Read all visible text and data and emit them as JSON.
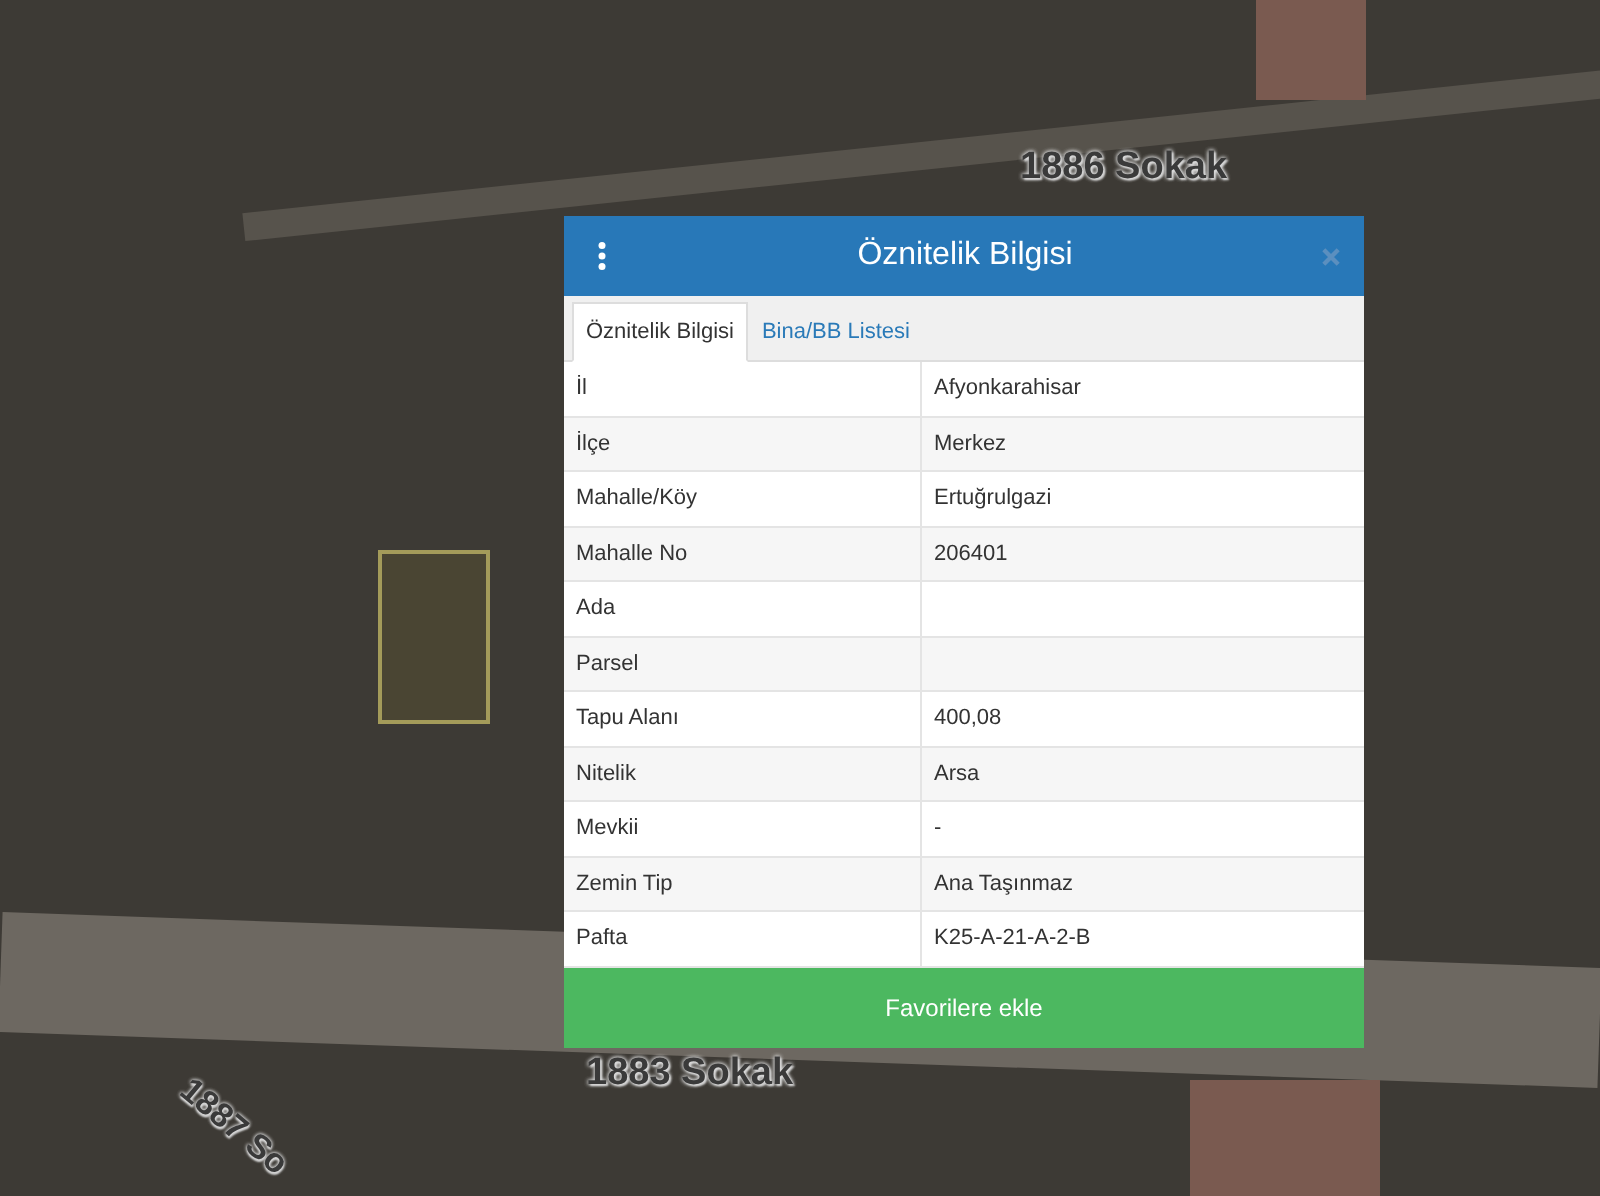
{
  "map": {
    "street_labels": [
      {
        "text": "1886 Sokak",
        "kind": "horizontal"
      },
      {
        "text": "1883 Sokak",
        "kind": "horizontal"
      },
      {
        "text": "1887 So",
        "kind": "diagonal"
      }
    ]
  },
  "dialog": {
    "title": "Öznitelik Bilgisi",
    "tabs": [
      {
        "label": "Öznitelik Bilgisi",
        "selected": true
      },
      {
        "label": "Bina/BB Listesi",
        "selected": false
      }
    ],
    "rows": [
      {
        "label": "İl",
        "value": "Afyonkarahisar"
      },
      {
        "label": "İlçe",
        "value": "Merkez"
      },
      {
        "label": "Mahalle/Köy",
        "value": "Ertuğrulgazi"
      },
      {
        "label": "Mahalle No",
        "value": "206401"
      },
      {
        "label": "Ada"
      },
      {
        "label": "Parsel"
      },
      {
        "label": "Tapu Alanı",
        "value": "400,08"
      },
      {
        "label": "Nitelik",
        "value": "Arsa"
      },
      {
        "label": "Mevkii",
        "value": "-"
      },
      {
        "label": "Zemin Tip",
        "value": "Ana Taşınmaz"
      },
      {
        "label": "Pafta",
        "value": "K25-A-21-A-2-B"
      }
    ],
    "button": "Favorilere ekle"
  }
}
